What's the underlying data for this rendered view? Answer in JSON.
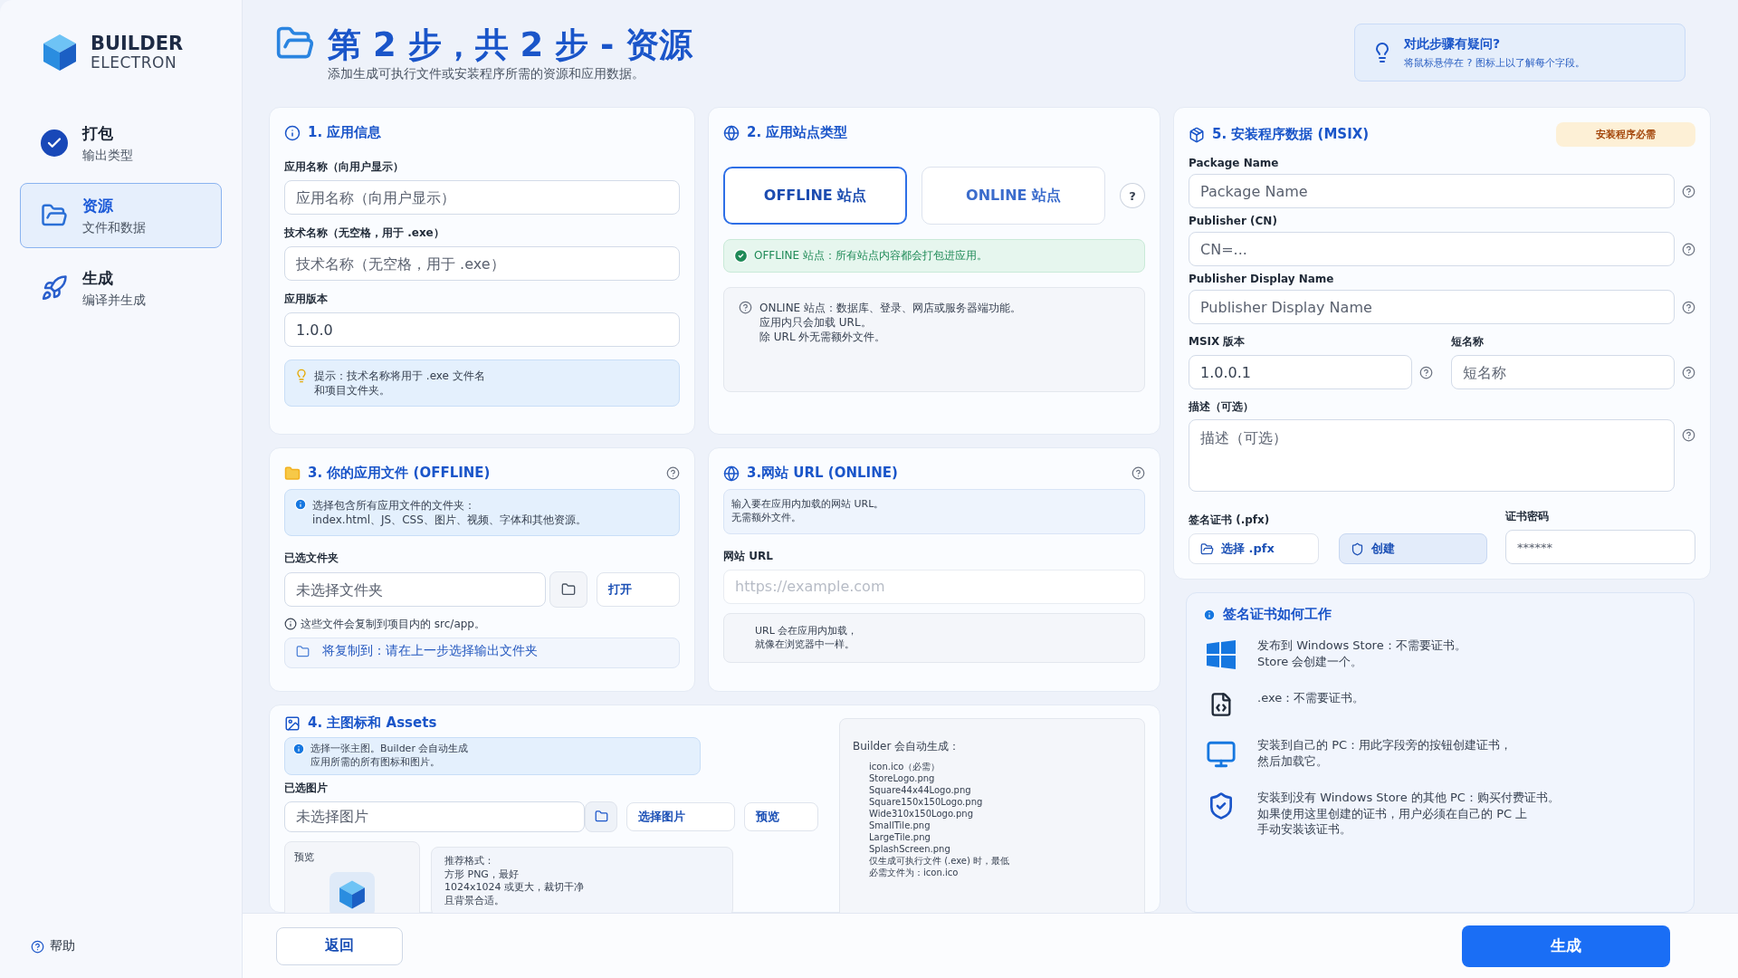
{
  "brand": {
    "line1": "BUILDER",
    "line2": "ELECTRON"
  },
  "sidebar": {
    "steps": [
      {
        "kind": "check",
        "title": "打包",
        "subtitle": "输出类型",
        "selected": false
      },
      {
        "kind": "folder",
        "title": "资源",
        "subtitle": "文件和数据",
        "selected": true
      },
      {
        "kind": "rocket",
        "title": "生成",
        "subtitle": "编译并生成",
        "selected": false
      }
    ],
    "help": "帮助"
  },
  "header": {
    "title": "第 2 步，共 2 步 - 资源",
    "subtitle": "添加生成可执行文件或安装程序所需的资源和应用数据。",
    "help_title": "对此步骤有疑问?",
    "help_text": "将鼠标悬停在 ? 图标上以了解每个字段。"
  },
  "app_info": {
    "title": "1. 应用信息",
    "fields": [
      {
        "label": "应用名称（向用户显示）",
        "placeholder": "应用名称（向用户显示）"
      },
      {
        "label": "技术名称（无空格，用于 .exe）",
        "placeholder": "技术名称（无空格，用于 .exe）"
      },
      {
        "label": "应用版本",
        "value": "1.0.0"
      }
    ],
    "tip": [
      "提示：技术名称将用于 .exe 文件名",
      "和项目文件夹。"
    ]
  },
  "site_type": {
    "title": "2. 应用站点类型",
    "options": [
      {
        "label": "OFFLINE 站点",
        "selected": true
      },
      {
        "label": "ONLINE 站点",
        "selected": false
      }
    ],
    "help_button": "?",
    "success_note": "OFFLINE 站点：所有站点内容都会打包进应用。",
    "online_note": [
      "ONLINE 站点：数据库、登录、网店或服务器端功能。",
      "应用内只会加载 URL。",
      "除 URL 外无需额外文件。"
    ]
  },
  "app_files": {
    "title": "3. 你的应用文件 (OFFLINE)",
    "info": "选择包含所有应用文件的文件夹：\nindex.html、JS、CSS、图片、视频、字体和其他资源。",
    "folder_label": "已选文件夹",
    "folder_placeholder": "未选择文件夹",
    "open_button": "打开",
    "note": "这些文件会复制到项目内的 src/app。",
    "copy_target": "将复制到：请在上一步选择输出文件夹"
  },
  "website_url": {
    "title": "3.网站 URL (ONLINE)",
    "info": [
      "输入要在应用内加载的网站 URL。",
      "无需额外文件。"
    ],
    "url_label": "网站 URL",
    "url_placeholder": "https://example.com",
    "note": [
      "URL 会在应用内加载，",
      "就像在浏览器中一样。"
    ]
  },
  "assets": {
    "title": "4. 主图标和 Assets",
    "info": [
      "选择一张主图。Builder 会自动生成",
      "应用所需的所有图标和图片。"
    ],
    "image_label": "已选图片",
    "image_placeholder": "未选择图片",
    "choose_button": "选择图片",
    "preview_button": "预览",
    "preview_label": "预览",
    "recommend": [
      "推荐格式：",
      "方形 PNG，最好",
      "1024x1024 或更大，裁切干净",
      "且背景合适。"
    ],
    "auto_title": "Builder 会自动生成：",
    "auto_files": [
      "icon.ico（必需）",
      "StoreLogo.png",
      "Square44x44Logo.png",
      "Square150x150Logo.png",
      "Wide310x150Logo.png",
      "SmallTile.png",
      "LargeTile.png",
      "SplashScreen.png"
    ],
    "auto_note": [
      "仅生成可执行文件 (.exe) 时，最低",
      "必需文件为：icon.ico"
    ]
  },
  "msix": {
    "title": "5. 安装程序数据 (MSIX)",
    "badge": "安装程序必需",
    "fields": [
      {
        "label": "Package Name",
        "placeholder": "Package Name"
      },
      {
        "label": "Publisher (CN)",
        "placeholder": "CN=..."
      },
      {
        "label": "Publisher Display Name",
        "placeholder": "Publisher Display Name"
      }
    ],
    "version_row": [
      {
        "label": "MSIX 版本",
        "value": "1.0.0.1"
      },
      {
        "label": "短名称",
        "placeholder": "短名称"
      }
    ],
    "description": {
      "label": "描述（可选）",
      "placeholder": "描述（可选）"
    },
    "cert_label": "签名证书 (.pfx)",
    "choose_pfx": "选择 .pfx",
    "create": "创建",
    "password_label": "证书密码",
    "password_placeholder": "******"
  },
  "cert_info": {
    "title": "签名证书如何工作",
    "items": [
      {
        "kind": "windows",
        "lines": [
          "发布到 Windows Store：不需要证书。",
          "Store 会创建一个。"
        ]
      },
      {
        "kind": "exe",
        "lines": [
          ".exe：不需要证书。"
        ]
      },
      {
        "kind": "monitor",
        "lines": [
          "安装到自己的 PC：用此字段旁的按钮创建证书，",
          "然后加载它。"
        ]
      },
      {
        "kind": "shield",
        "lines": [
          "安装到没有 Windows Store 的其他 PC：购买付费证书。",
          "如果使用这里创建的证书，用户必须在自己的 PC 上",
          "手动安装该证书。"
        ]
      }
    ]
  },
  "footer": {
    "back": "返回",
    "generate": "生成"
  }
}
